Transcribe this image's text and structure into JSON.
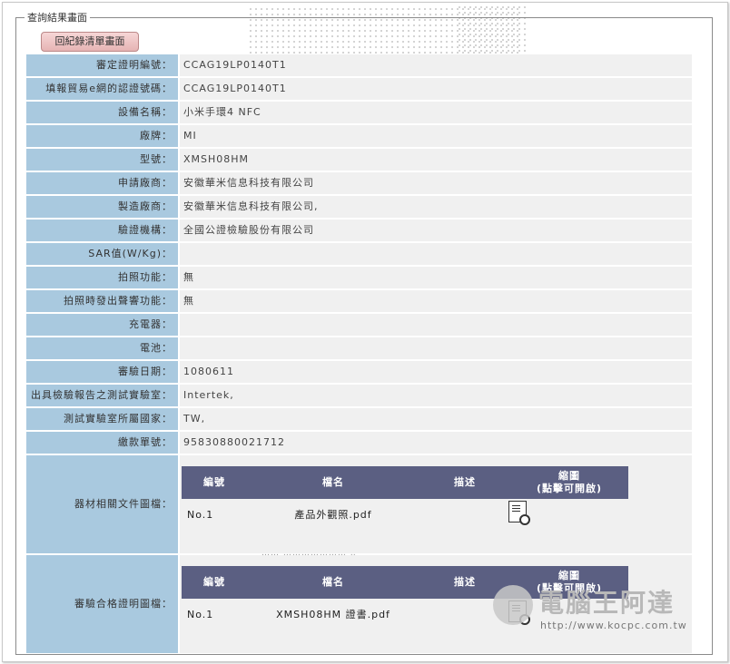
{
  "legend": "查詢結果畫面",
  "back_button": "回紀錄清單畫面",
  "rows": [
    {
      "label": "審定證明編號：",
      "value": "CCAG19LP0140T1"
    },
    {
      "label": "填報貿易e網的認證號碼：",
      "value": "CCAG19LP0140T1"
    },
    {
      "label": "設備名稱：",
      "value": "小米手環4 NFC"
    },
    {
      "label": "廠牌：",
      "value": "MI"
    },
    {
      "label": "型號：",
      "value": "XMSH08HM"
    },
    {
      "label": "申請廠商：",
      "value": "安徽華米信息科技有限公司"
    },
    {
      "label": "製造廠商：",
      "value": "安徽華米信息科技有限公司,"
    },
    {
      "label": "驗證機構：",
      "value": "全國公證檢驗股份有限公司"
    },
    {
      "label": "SAR值(W/Kg)：",
      "value": ""
    },
    {
      "label": "拍照功能：",
      "value": "無"
    },
    {
      "label": "拍照時發出聲響功能：",
      "value": "無"
    },
    {
      "label": "充電器：",
      "value": ""
    },
    {
      "label": "電池：",
      "value": ""
    },
    {
      "label": "審驗日期：",
      "value": "1080611"
    },
    {
      "label": "出具檢驗報告之測試實驗室：",
      "value": "Intertek,"
    },
    {
      "label": "測試實驗室所屬國家：",
      "value": "TW,"
    },
    {
      "label": "繳款單號：",
      "value": "95830880021712"
    }
  ],
  "equipment_docs": {
    "label": "器材相關文件圖檔：",
    "headers": {
      "no": "編號",
      "name": "檔名",
      "desc": "描述",
      "thumb": "縮圖",
      "thumb_hint": "(點擊可開啟)"
    },
    "file": {
      "no": "No.1",
      "name": "產品外觀照.pdf",
      "desc": "",
      "icon": "pdf-preview-icon"
    }
  },
  "cert_docs": {
    "label": "審驗合格證明圖檔：",
    "headers": {
      "no": "編號",
      "name": "檔名",
      "desc": "描述",
      "thumb": "縮圖",
      "thumb_hint": "(點擊可開啟)"
    },
    "file": {
      "no": "No.1",
      "name": "XMSH08HM 證書.pdf",
      "desc": "",
      "icon": "pdf-preview-icon"
    }
  },
  "watermark": {
    "title": "電腦王阿達",
    "url": "http://www.kocpc.com.tw"
  },
  "colors": {
    "label_bg": "#a9c9df",
    "value_bg": "#f0f0f0",
    "subhead_bg": "#5b5f82",
    "button_bg": "#e6b4b4"
  }
}
